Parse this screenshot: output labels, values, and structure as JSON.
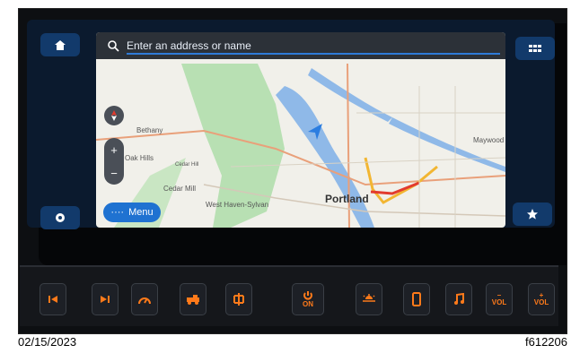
{
  "search": {
    "placeholder": "Enter an address or name"
  },
  "map": {
    "menu_label": "Menu",
    "labels": {
      "bethany": "Bethany",
      "oak_hills": "Oak Hills",
      "cedar_hill": "Cedar Hill",
      "cedar_mill": "Cedar Mill",
      "west_haven": "West Haven-Sylvan",
      "portland": "Portland",
      "maywood": "Maywood"
    }
  },
  "controls": {
    "on_label": "ON",
    "vol_minus": "VOL",
    "vol_plus": "VOL"
  },
  "footer": {
    "date": "02/15/2023",
    "figure_id": "f612206"
  },
  "colors": {
    "accent": "#1f72d1",
    "indicator": "#ff7a1a",
    "water": "#8fb9e8",
    "park": "#b8e0b3"
  },
  "icons": [
    "home-icon",
    "grid-icon",
    "settings-icon",
    "star-icon",
    "search-icon",
    "compass-icon",
    "zoom-in-icon",
    "zoom-out-icon",
    "position-arrow-icon",
    "prev-track-icon",
    "next-track-icon",
    "speedometer-icon",
    "vehicle-icon",
    "diff-lock-icon",
    "power-icon",
    "light-icon",
    "phone-icon",
    "music-icon"
  ]
}
